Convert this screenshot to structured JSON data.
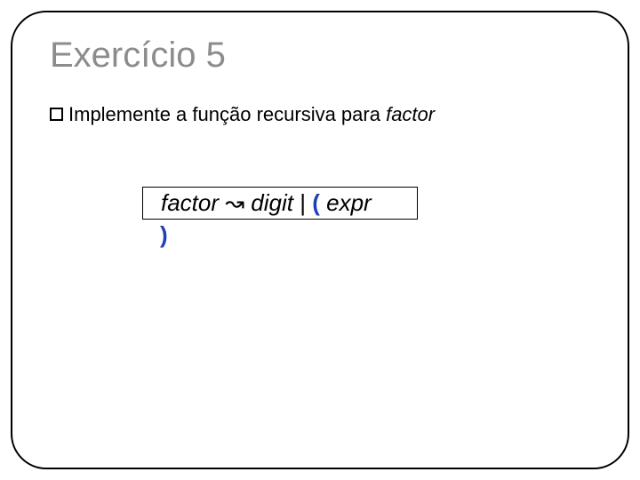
{
  "title": "Exercício 5",
  "bullet": {
    "text_prefix": "Implemente a função recursiva para ",
    "emph": "factor"
  },
  "grammar": {
    "lhs": "factor",
    "arrow": "↝",
    "rhs_digit": "digit",
    "pipe": "|",
    "lparen": "(",
    "rhs_expr": "expr",
    "rparen": ")"
  }
}
